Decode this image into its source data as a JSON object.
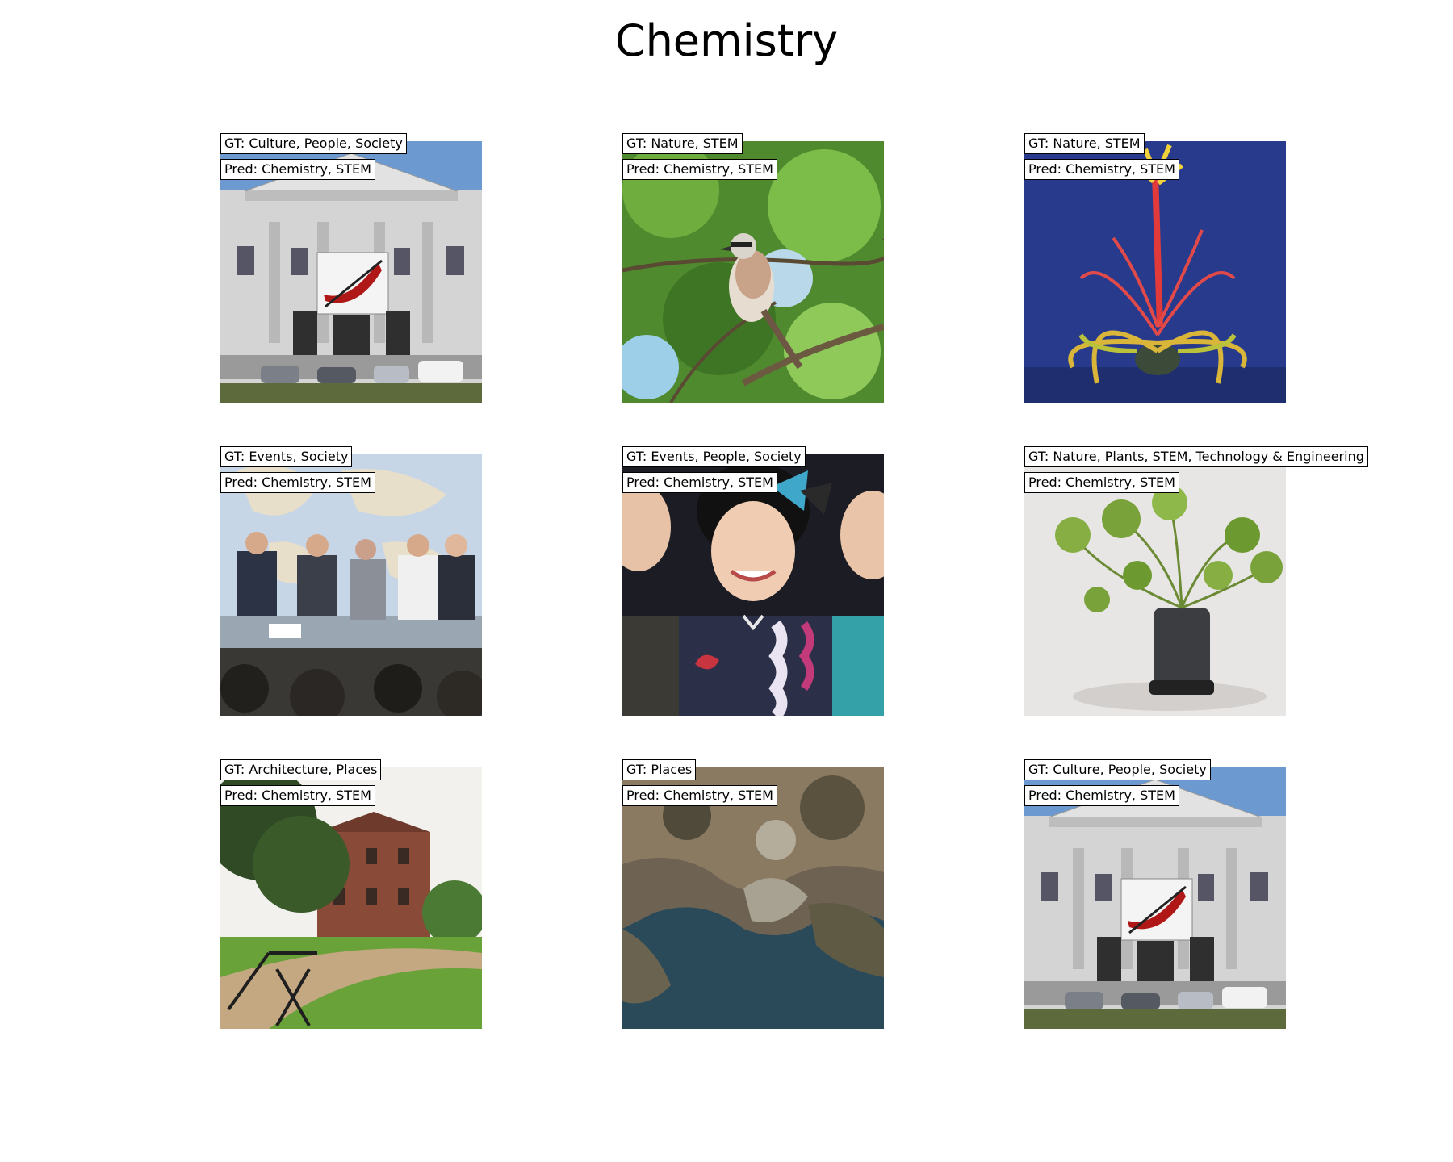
{
  "title": "Chemistry",
  "panels": [
    {
      "gt": "GT: Culture, People, Society",
      "pred": "Pred: Chemistry, STEM",
      "subject": "building-facade"
    },
    {
      "gt": "GT: Nature, STEM",
      "pred": "Pred: Chemistry, STEM",
      "subject": "bird-on-branch"
    },
    {
      "gt": "GT: Nature, STEM",
      "pred": "Pred: Chemistry, STEM",
      "subject": "air-plant"
    },
    {
      "gt": "GT: Events, Society",
      "pred": "Pred: Chemistry, STEM",
      "subject": "panel-discussion"
    },
    {
      "gt": "GT: Events, People, Society",
      "pred": "Pred: Chemistry, STEM",
      "subject": "smiling-woman"
    },
    {
      "gt": "GT: Nature, Plants, STEM, Technology & Engineering",
      "pred": "Pred: Chemistry, STEM",
      "subject": "potted-plant"
    },
    {
      "gt": "GT: Architecture, Places",
      "pred": "Pred: Chemistry, STEM",
      "subject": "brick-manor"
    },
    {
      "gt": "GT: Places",
      "pred": "Pred: Chemistry, STEM",
      "subject": "aerial-coast"
    },
    {
      "gt": "GT: Culture, People, Society",
      "pred": "Pred: Chemistry, STEM",
      "subject": "building-facade"
    }
  ]
}
